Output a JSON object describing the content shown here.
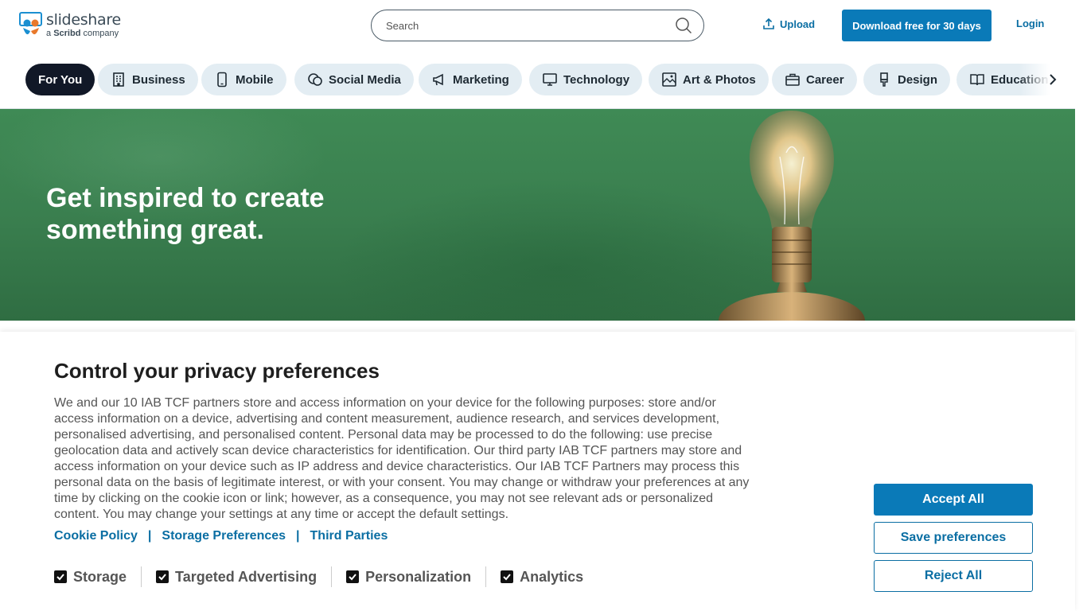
{
  "header": {
    "logo_name": "slideshare",
    "logo_sub_prefix": "a ",
    "logo_sub_brand": "Scribd",
    "logo_sub_suffix": " company",
    "search_placeholder": "Search",
    "upload_label": "Upload",
    "download_label": "Download free for 30 days",
    "login_label": "Login"
  },
  "categories": [
    {
      "label": "For You",
      "icon": "none",
      "active": true
    },
    {
      "label": "Business",
      "icon": "building-icon"
    },
    {
      "label": "Mobile",
      "icon": "phone-icon"
    },
    {
      "label": "Social Media",
      "icon": "chat-icon"
    },
    {
      "label": "Marketing",
      "icon": "megaphone-icon"
    },
    {
      "label": "Technology",
      "icon": "monitor-icon"
    },
    {
      "label": "Art & Photos",
      "icon": "image-icon"
    },
    {
      "label": "Career",
      "icon": "briefcase-icon"
    },
    {
      "label": "Design",
      "icon": "brush-icon"
    },
    {
      "label": "Education",
      "icon": "book-icon"
    }
  ],
  "hero": {
    "title_line1": "Get inspired to create",
    "title_line2": "something great."
  },
  "privacy": {
    "title": "Control your privacy preferences",
    "body": "We and our 10 IAB TCF partners store and access information on your device for the following purposes: store and/or access information on a device, advertising and content measurement, audience research, and services development, personalised advertising, and personalised content. Personal data may be processed to do the following: use precise geolocation data and actively scan device characteristics for identification. Our third party IAB TCF partners may store and access information on your device such as IP address and device characteristics. Our IAB TCF Partners may process this personal data on the basis of legitimate interest, or with your consent. You may change or withdraw your preferences at any time by clicking on the cookie icon or link; however, as a consequence, you may not see relevant ads or personalized content. You may change your settings at any time or accept the default settings.",
    "links": [
      "Cookie Policy",
      "Storage Preferences",
      "Third Parties"
    ],
    "link_separator": "|",
    "checkboxes": [
      {
        "label": "Storage",
        "checked": true
      },
      {
        "label": "Targeted Advertising",
        "checked": true
      },
      {
        "label": "Personalization",
        "checked": true
      },
      {
        "label": "Analytics",
        "checked": true
      }
    ],
    "accept_label": "Accept All",
    "save_label": "Save preferences",
    "reject_label": "Reject All"
  },
  "colors": {
    "brand_blue": "#0a7ab8",
    "active_pill": "#111827",
    "pill_bg": "#e3edf3",
    "hero_green": "#3a7f4f"
  }
}
